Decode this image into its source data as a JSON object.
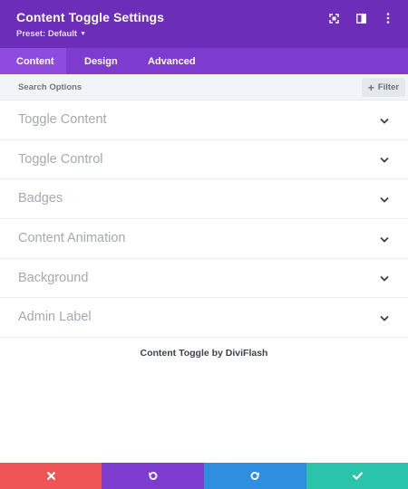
{
  "colors": {
    "header_bg": "#6c2eb9",
    "tabs_bg": "#7d3bcf",
    "tab_active_bg": "#8f4ae0",
    "cancel": "#ef5456",
    "undo": "#7d3bcf",
    "redo": "#2e8ee0",
    "save": "#29c4a9"
  },
  "header": {
    "title": "Content Toggle Settings",
    "preset_label": "Preset: Default",
    "icons": [
      "expand-icon",
      "sidebar-layout-icon",
      "more-vertical-icon"
    ]
  },
  "tabs": [
    {
      "label": "Content",
      "active": true
    },
    {
      "label": "Design",
      "active": false
    },
    {
      "label": "Advanced",
      "active": false
    }
  ],
  "search": {
    "placeholder": "Search Options",
    "filter_label": "Filter"
  },
  "sections": [
    {
      "label": "Toggle Content"
    },
    {
      "label": "Toggle Control"
    },
    {
      "label": "Badges"
    },
    {
      "label": "Content Animation"
    },
    {
      "label": "Background"
    },
    {
      "label": "Admin Label"
    }
  ],
  "credit": "Content Toggle by DiviFlash",
  "actions": {
    "cancel_icon": "close-icon",
    "undo_icon": "undo-icon",
    "redo_icon": "redo-icon",
    "save_icon": "check-icon"
  }
}
